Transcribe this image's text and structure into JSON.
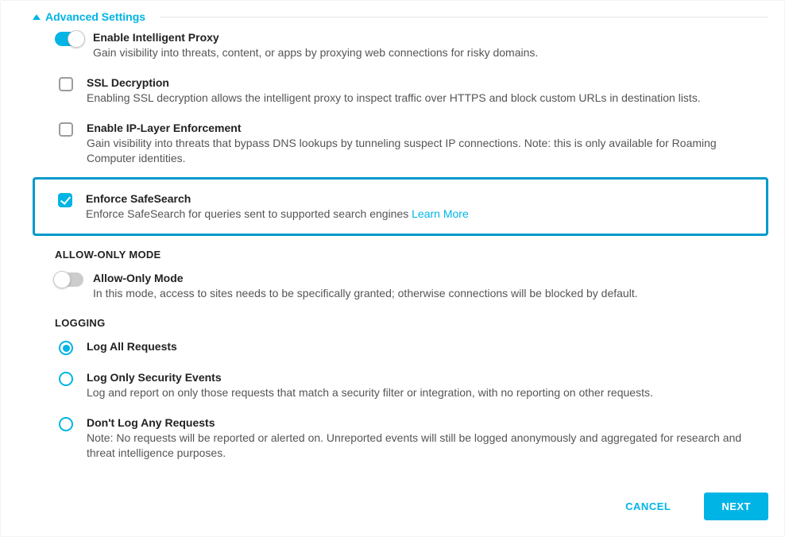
{
  "adv_settings_label": "Advanced Settings",
  "settings": {
    "intelligent_proxy": {
      "title": "Enable Intelligent Proxy",
      "desc": "Gain visibility into threats, content, or apps by proxying web connections for risky domains."
    },
    "ssl": {
      "title": "SSL Decryption",
      "desc": "Enabling SSL decryption allows the intelligent proxy to inspect traffic over HTTPS and block custom URLs in destination lists."
    },
    "ip_layer": {
      "title": "Enable IP-Layer Enforcement",
      "desc": "Gain visibility into threats that bypass DNS lookups by tunneling suspect IP connections. Note: this is only available for Roaming Computer identities."
    },
    "safesearch": {
      "title": "Enforce SafeSearch",
      "desc": "Enforce SafeSearch for queries sent to supported search engines ",
      "learn_more": "Learn More"
    }
  },
  "allow_only": {
    "header": "ALLOW-ONLY MODE",
    "title": "Allow-Only Mode",
    "desc": "In this mode, access to sites needs to be specifically granted; otherwise connections will be blocked by default."
  },
  "logging": {
    "header": "LOGGING",
    "options": {
      "all": {
        "title": "Log All Requests"
      },
      "security": {
        "title": "Log Only Security Events",
        "desc": "Log and report on only those requests that match a security filter or integration, with no reporting on other requests."
      },
      "none": {
        "title": "Don't Log Any Requests",
        "desc": "Note: No requests will be reported or alerted on. Unreported events will still be logged anonymously and aggregated for research and threat intelligence purposes."
      }
    }
  },
  "footer": {
    "cancel": "CANCEL",
    "next": "NEXT"
  }
}
